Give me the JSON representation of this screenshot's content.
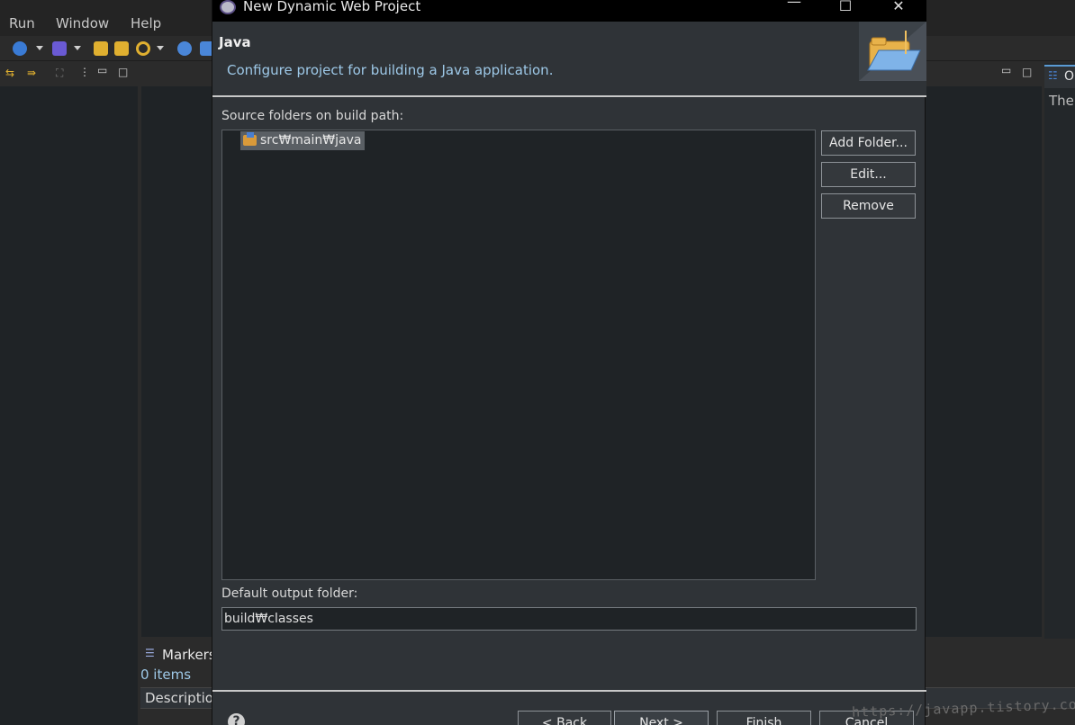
{
  "menu": {
    "run": "Run",
    "window": "Window",
    "help": "Help"
  },
  "dialog": {
    "title": "New Dynamic Web Project",
    "window_controls": {
      "minimize": "—",
      "maximize": "☐",
      "close": "✕"
    },
    "header": {
      "title": "Java",
      "description": "Configure project for building a Java application.",
      "image_icon": "open-folder-icon"
    },
    "source_folders_label": "Source folders on build path:",
    "source_folders": [
      {
        "path": "src₩main₩java",
        "icon": "source-folder-icon",
        "selected": true
      }
    ],
    "buttons": {
      "add_folder": "Add Folder...",
      "edit": "Edit...",
      "remove": "Remove"
    },
    "output_label": "Default output folder:",
    "output_value": "build₩classes",
    "footer": {
      "back": "< Back",
      "next": "Next >",
      "finish": "Finish",
      "cancel": "Cancel",
      "help": "?"
    }
  },
  "bottom_panel": {
    "markers_tab": "Markers",
    "items_count": "0 items",
    "description_col": "Description"
  },
  "right_panel": {
    "tab_label": "O",
    "text": "Ther"
  },
  "watermark": "https://javapp.tistory.com/",
  "colors": {
    "accent_link": "#9ec9e8",
    "dialog_bg": "#2f3337",
    "list_bg": "#1f2326"
  }
}
